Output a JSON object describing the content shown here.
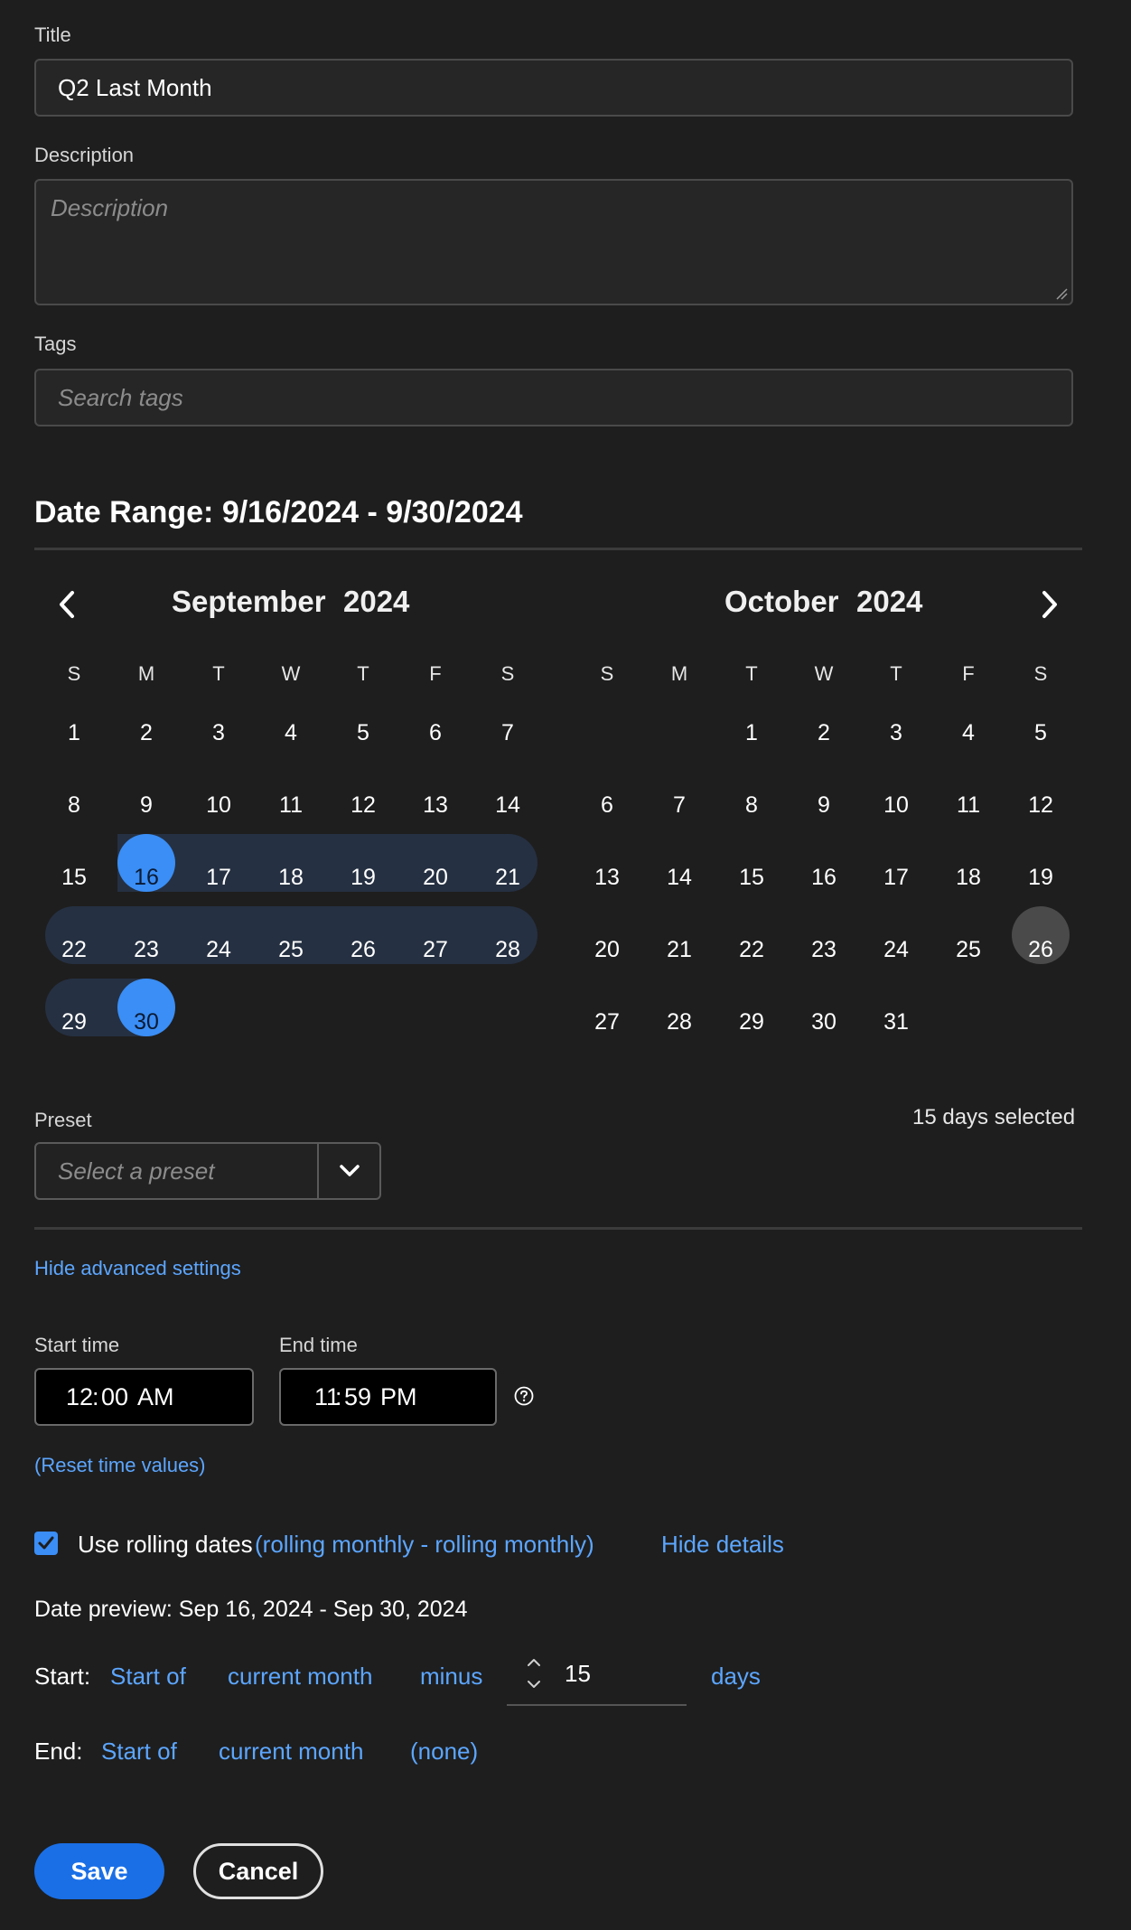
{
  "form": {
    "title_label": "Title",
    "title_value": "Q2 Last Month",
    "description_label": "Description",
    "description_placeholder": "Description",
    "tags_label": "Tags",
    "tags_placeholder": "Search tags"
  },
  "date_range": {
    "heading": "Date Range: 9/16/2024 - 9/30/2024",
    "days_selected": "15 days selected"
  },
  "calendar": {
    "left": {
      "month": "September",
      "year": "2024",
      "weekdays": [
        "S",
        "M",
        "T",
        "W",
        "T",
        "F",
        "S"
      ],
      "weeks": [
        [
          "1",
          "2",
          "3",
          "4",
          "5",
          "6",
          "7"
        ],
        [
          "8",
          "9",
          "10",
          "11",
          "12",
          "13",
          "14"
        ],
        [
          "15",
          "16",
          "17",
          "18",
          "19",
          "20",
          "21"
        ],
        [
          "22",
          "23",
          "24",
          "25",
          "26",
          "27",
          "28"
        ],
        [
          "29",
          "30",
          "",
          "",
          "",
          "",
          ""
        ]
      ]
    },
    "right": {
      "month": "October",
      "year": "2024",
      "weekdays": [
        "S",
        "M",
        "T",
        "W",
        "T",
        "F",
        "S"
      ],
      "weeks": [
        [
          "",
          "",
          "1",
          "2",
          "3",
          "4",
          "5"
        ],
        [
          "6",
          "7",
          "8",
          "9",
          "10",
          "11",
          "12"
        ],
        [
          "13",
          "14",
          "15",
          "16",
          "17",
          "18",
          "19"
        ],
        [
          "20",
          "21",
          "22",
          "23",
          "24",
          "25",
          "26"
        ],
        [
          "27",
          "28",
          "29",
          "30",
          "31",
          "",
          ""
        ]
      ]
    },
    "selected_start": "16",
    "selected_end": "30",
    "today": "26",
    "accent_color": "#3a8ef5",
    "range_color": "#253042",
    "today_color": "#4a4a4a"
  },
  "preset": {
    "label": "Preset",
    "placeholder": "Select a preset"
  },
  "advanced": {
    "toggle_label": "Hide advanced settings",
    "start_time_label": "Start time",
    "start_time": {
      "hour": "12",
      "minute": "00",
      "ampm": "AM"
    },
    "end_time_label": "End time",
    "end_time": {
      "hour": "11",
      "minute": "59",
      "ampm": "PM"
    },
    "reset_link": "(Reset time values)"
  },
  "rolling": {
    "checkbox_label": "Use rolling dates",
    "checked": true,
    "summary_link": "(rolling monthly - rolling monthly)",
    "hide_details": "Hide details",
    "preview": "Date preview: Sep 16, 2024 - Sep 30, 2024",
    "start": {
      "label": "Start:",
      "anchor": "Start of",
      "period": "current month",
      "operator": "minus",
      "amount": "15",
      "unit": "days"
    },
    "end": {
      "label": "End:",
      "anchor": "Start of",
      "period": "current month",
      "operator": "(none)"
    }
  },
  "actions": {
    "save": "Save",
    "cancel": "Cancel"
  }
}
